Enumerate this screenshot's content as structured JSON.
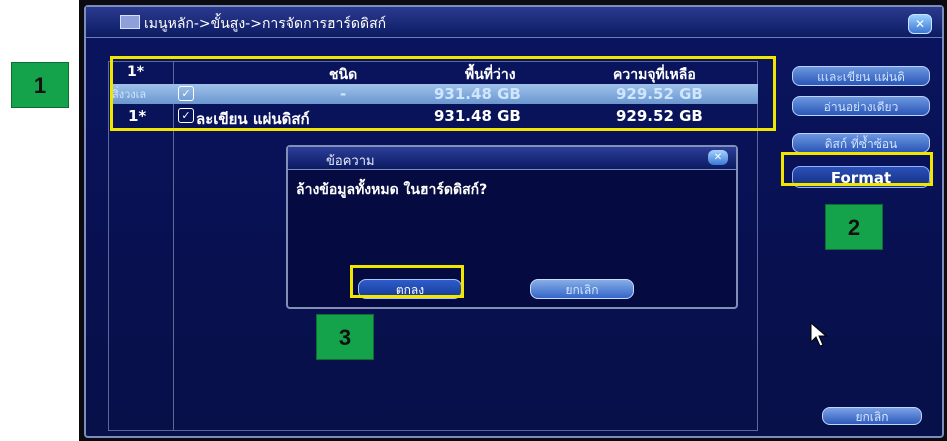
{
  "window": {
    "title": "เมนูหลัก->ขั้นสูง->การจัดการฮาร์ดดิสก์",
    "close_glyph": "✕"
  },
  "table": {
    "headers": {
      "no": "1*",
      "type": "ชนิด",
      "free_space": "พื้นที่ว่าง",
      "remaining": "ความจุที่เหลือ"
    },
    "rows": [
      {
        "no": "สิ่งวงเล",
        "checked": "✓",
        "type": "-",
        "free_space": "931.48 GB",
        "remaining": "929.52 GB",
        "selected": true
      },
      {
        "no": "1*",
        "checked": "✓",
        "type": "ละเขียน แผ่นดิสก์",
        "free_space": "931.48 GB",
        "remaining": "929.52 GB",
        "selected": false
      }
    ]
  },
  "side_buttons": {
    "read_write": "แเละเขียน แผ่นดิ",
    "read_only": "อ่านอย่างเดียว",
    "redundant": "ดิสก์ ที่ซ้ำซ้อน",
    "format": "Format",
    "cancel": "ยกเลิก"
  },
  "dialog": {
    "title": "ข้อความ",
    "close_glyph": "✕",
    "message": "ล้างข้อมูลทั้งหมด ในฮาร์ดดิสก์?",
    "ok": "ตกลง",
    "cancel": "ยกเลิก"
  },
  "callouts": {
    "one": "1",
    "two": "2",
    "three": "3"
  },
  "colors": {
    "highlight": "#f2e600",
    "callout_bg": "#14a24a",
    "window_bg": "#0a1560"
  }
}
